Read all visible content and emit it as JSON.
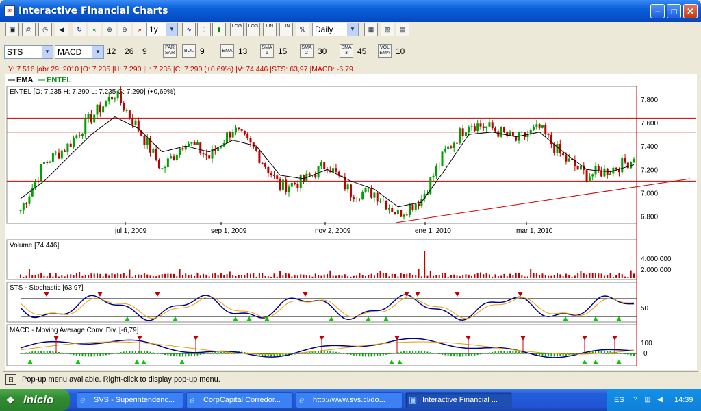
{
  "window": {
    "title": "Interactive Financial Charts"
  },
  "toolbar1": {
    "period": "1y",
    "interval": "Daily",
    "buttons": [
      "LOG",
      "LOG",
      "LIN",
      "LIN",
      "%"
    ]
  },
  "toolbar2": {
    "symbol": "STS",
    "indicator": "MACD",
    "macd_params": [
      "12",
      "26",
      "9"
    ],
    "par_sar": "PAR\nSAR",
    "bol_label": "BOL",
    "bol_value": "9",
    "ema_label": "EMA",
    "ema_value": "13",
    "sma1_label": "SMA 1",
    "sma1_value": "15",
    "sma2_label": "SMA 2",
    "sma2_value": "30",
    "sma3_label": "SMA 3",
    "sma3_value": "45",
    "vol_ema_label": "VOL EMA",
    "vol_ema_value": "10"
  },
  "info_line": "Y: 7.516 |abr 29, 2010 |O: 7.235 |H: 7.290 |L: 7.235 |C: 7.290 (+0,69%) |V: 74.446 |STS: 63,97 |MACD: -6,79",
  "legend": {
    "ema": "EMA",
    "entel": "ENTEL"
  },
  "price_panel": {
    "label": "ENTEL [O: 7.235  H: 7.290  L: 7.235  C: 7.290] (+0,69%)",
    "yticks": [
      "7.800",
      "7.600",
      "7.400",
      "7.200",
      "7.000",
      "6.800"
    ],
    "xticks": [
      "jul 1, 2009",
      "sep 1, 2009",
      "nov 2, 2009",
      "ene 1, 2010",
      "mar 1, 2010"
    ]
  },
  "volume_panel": {
    "label": "Volume [74.446]",
    "yticks": [
      "4.000.000",
      "2.000.000"
    ]
  },
  "sts_panel": {
    "label": "STS - Stochastic [63,97]",
    "yticks": [
      "50"
    ]
  },
  "macd_panel": {
    "label": "MACD - Moving Average Conv. Div. [-6,79]",
    "yticks": [
      "100",
      "0"
    ]
  },
  "colors": {
    "up": "#00a000",
    "down": "#c00000",
    "blue": "#00008b",
    "orange": "#e8a000"
  },
  "status": "Pop-up menu available. Right-click to display pop-up menu.",
  "taskbar": {
    "start": "Inicio",
    "tasks": [
      "SVS - Superintendenc...",
      "CorpCapital Corredor...",
      "http://www.svs.cl/do...",
      "Interactive Financial ..."
    ],
    "lang": "ES",
    "clock": "14:39"
  },
  "chart_data": {
    "type": "candlestick",
    "series": [
      {
        "name": "ENTEL",
        "x": [
          "2009-05-04",
          "2009-05-18",
          "2009-06-01",
          "2009-06-08",
          "2009-06-15",
          "2009-06-22",
          "2009-07-01",
          "2009-07-15",
          "2009-08-03",
          "2009-08-17",
          "2009-09-01",
          "2009-09-15",
          "2009-10-01",
          "2009-10-15",
          "2009-11-02",
          "2009-11-16",
          "2009-12-01",
          "2009-12-15",
          "2010-01-01",
          "2010-01-15",
          "2010-02-01",
          "2010-02-15",
          "2010-03-01",
          "2010-03-15",
          "2010-04-01",
          "2010-04-15",
          "2010-04-29"
        ],
        "close": [
          6.85,
          7.25,
          7.4,
          7.65,
          7.85,
          7.55,
          7.2,
          7.45,
          7.3,
          7.55,
          7.35,
          7.05,
          7.1,
          7.25,
          7.0,
          7.0,
          6.82,
          6.95,
          7.35,
          7.6,
          7.55,
          7.45,
          7.55,
          7.3,
          7.15,
          7.2,
          7.29
        ]
      },
      {
        "name": "EMA",
        "values": [
          6.95,
          7.1,
          7.3,
          7.5,
          7.65,
          7.55,
          7.35,
          7.4,
          7.35,
          7.45,
          7.4,
          7.15,
          7.12,
          7.2,
          7.1,
          7.03,
          6.88,
          6.92,
          7.2,
          7.5,
          7.52,
          7.48,
          7.52,
          7.35,
          7.2,
          7.18,
          7.24
        ]
      }
    ],
    "ylim": [
      6.75,
      7.9
    ],
    "hlines": [
      7.64,
      7.52,
      7.1
    ]
  }
}
